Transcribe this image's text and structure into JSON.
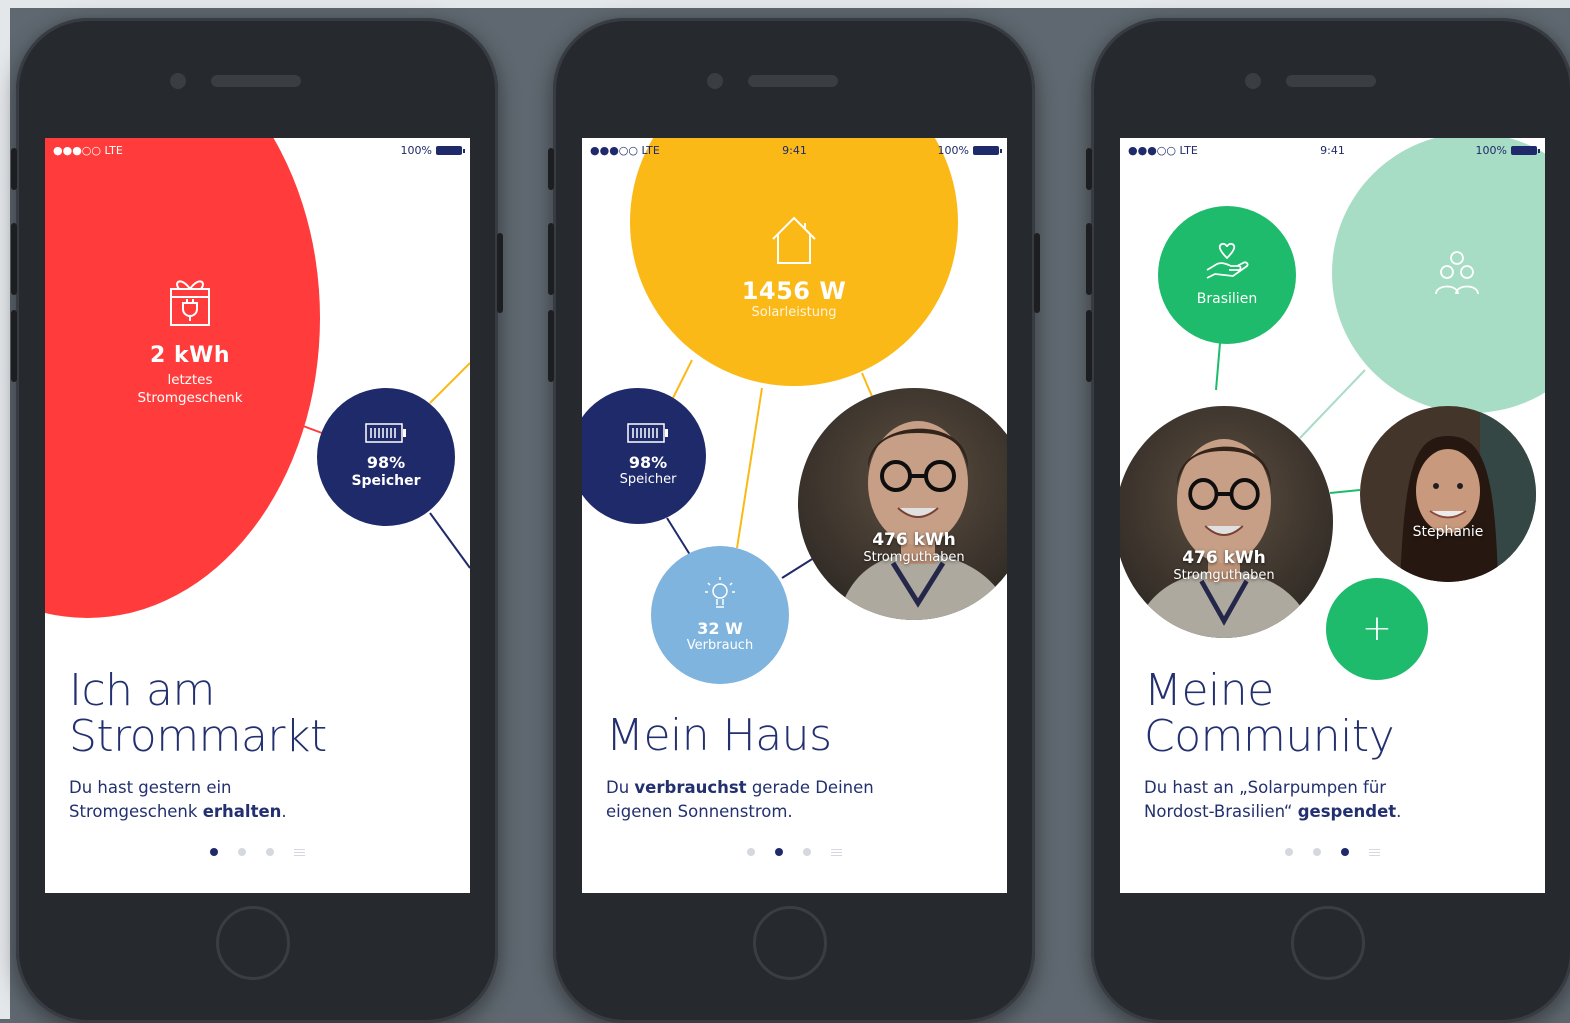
{
  "colors": {
    "red": "#ff3b3b",
    "navy": "#1f2a6b",
    "yellow": "#fbb917",
    "lightblue": "#7fb4de",
    "green": "#1dbb6b",
    "mint": "#a7ddc5"
  },
  "status": {
    "signal": "●●●○○ LTE",
    "time": "9:41",
    "battery": "100%"
  },
  "screens": [
    {
      "big_bubble": {
        "icon": "gift-plug-icon",
        "value": "2 kWh",
        "label_line1": "letztes",
        "label_line2": "Stromgeschenk"
      },
      "storage": {
        "icon": "battery-icon",
        "value": "98%",
        "label": "Speicher"
      },
      "headline_line1": "Ich am",
      "headline_line2": "Strommarkt",
      "desc_plain": "Du hast gestern ein Stromgeschenk ",
      "desc_bold": "erhalten",
      "desc_end": ".",
      "page_index": 0
    },
    {
      "solar": {
        "icon": "house-icon",
        "value": "1456 W",
        "label": "Solarleistung"
      },
      "storage": {
        "icon": "battery-icon",
        "value": "98%",
        "label": "Speicher"
      },
      "consumption": {
        "icon": "lightbulb-icon",
        "value": "32 W",
        "label": "Verbrauch"
      },
      "credit": {
        "value": "476 kWh",
        "label": "Stromguthaben"
      },
      "headline": "Mein Haus",
      "desc_plain1": "Du ",
      "desc_bold": "verbrauchst",
      "desc_plain2": " gerade Deinen eigenen Sonnenstrom.",
      "page_index": 1
    },
    {
      "donation": {
        "icon": "heart-hand-icon",
        "label": "Brasilien"
      },
      "community_icon": "people-icon",
      "credit": {
        "value": "476 kWh",
        "label": "Stromguthaben"
      },
      "friend": {
        "label": "Stephanie"
      },
      "add_label": "+",
      "headline_line1": "Meine",
      "headline_line2": "Community",
      "desc_plain": "Du hast an „Solarpumpen für Nordost-Brasilien“ ",
      "desc_bold": "gespendet",
      "desc_end": ".",
      "page_index": 2
    }
  ]
}
